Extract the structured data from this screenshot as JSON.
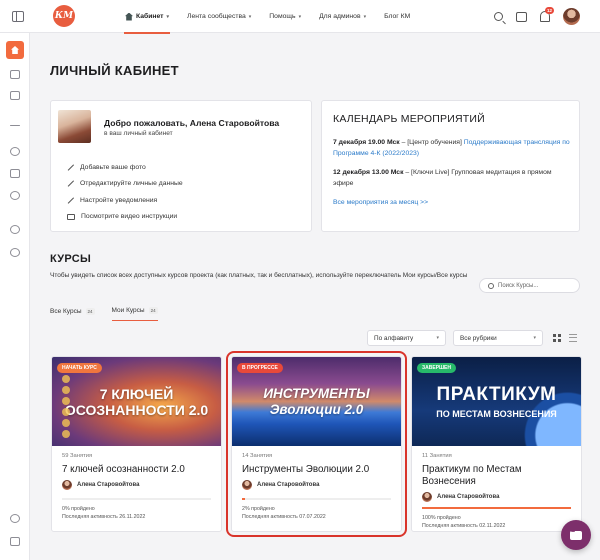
{
  "header": {
    "logo_text": "КМ",
    "nav": [
      {
        "label": "Кабинет",
        "has_chevron": true,
        "active": true
      },
      {
        "label": "Лента сообщества",
        "has_chevron": true
      },
      {
        "label": "Помощь",
        "has_chevron": true
      },
      {
        "label": "Для админов",
        "has_chevron": true
      },
      {
        "label": "Блог КМ",
        "has_chevron": false
      }
    ],
    "notification_count": "12",
    "icons": [
      "sidebar-toggle-icon",
      "search-icon",
      "inbox-icon",
      "bell-icon",
      "avatar"
    ]
  },
  "sidebar_rail": {
    "icons": [
      "home-icon",
      "graduation-cap-icon",
      "briefcase-icon",
      "activity-icon",
      "groups-icon",
      "chat-icon",
      "members-icon",
      "help-icon",
      "settings-icon",
      "collapse-icon"
    ]
  },
  "page": {
    "title": "ЛИЧНЫЙ КАБИНЕТ"
  },
  "welcome": {
    "greeting": "Добро пожаловать,  Алена Старовойтова",
    "subtitle": "в ваш личный кабинет",
    "actions": [
      "Добавьте ваше фото",
      "Отредактируйте личные данные",
      "Настройте уведомления",
      "Посмотрите видео инструкции"
    ]
  },
  "events": {
    "title": "КАЛЕНДАРЬ МЕРОПРИЯТИЙ",
    "items": [
      {
        "date": "7 декабря 19.00 Мск",
        "prefix": " – [Центр обучения] ",
        "link": "Поддерживающая трансляция по Программе 4-К (2022/2023)",
        "rest": ""
      },
      {
        "date": "12 декабря 13.00 Мск",
        "prefix": " – [Ключи Live] Групповая медитация в прямом эфире",
        "link": "",
        "rest": ""
      }
    ],
    "all_link": "Все мероприятия за месяц >>"
  },
  "courses_section": {
    "title": "КУРСЫ",
    "description": "Чтобы увидеть список всех доступных курсов проекта (как платных, так и бесплатных), используйте переключатель Мои курсы/Все курсы",
    "search_placeholder": "Поиск Курсы...",
    "tabs": [
      {
        "label": "Все Курсы",
        "count": "24",
        "active": false
      },
      {
        "label": "Мои Курсы",
        "count": "24",
        "active": true
      }
    ],
    "sort_select": "По алфавиту",
    "category_select": "Все рубрики",
    "view": "grid"
  },
  "courses": [
    {
      "status": "НАЧАТЬ КУРС",
      "status_color": "#f0763e",
      "banner_text": "7 КЛЮЧЕЙ ОСОЗНАННОСТИ 2.0",
      "banner_line1": "7 КЛЮЧЕЙ",
      "banner_line2": "ОСОЗНАННОСТИ 2.0",
      "lessons": "59 Занятия",
      "title": "7 ключей осознанности 2.0",
      "author": "Алена Старовойтова",
      "progress": 0,
      "progress_text": "0% пройдено",
      "last_activity": "Последняя активность 26.11.2022"
    },
    {
      "status": "В ПРОГРЕССЕ",
      "status_color": "#e8493a",
      "banner_line1": "ИНСТРУМЕНТЫ",
      "banner_line2": "Эволюции 2.0",
      "lessons": "14 Занятия",
      "title": "Инструменты Эволюции 2.0",
      "author": "Алена Старовойтова",
      "progress": 2,
      "progress_text": "2% пройдено",
      "last_activity": "Последняя активность 07.07.2022",
      "highlighted": true
    },
    {
      "status": "ЗАВЕРШЕН",
      "status_color": "#27b96a",
      "banner_line1": "ПРАКТИКУМ",
      "banner_line2": "ПО МЕСТАМ ВОЗНЕСЕНИЯ",
      "lessons": "11 Занятия",
      "title": "Практикум по Местам Вознесения",
      "author": "Алена Старовойтова",
      "progress": 100,
      "progress_text": "100% пройдено",
      "last_activity": "Последняя активность 02.11.2022"
    }
  ],
  "colors": {
    "accent": "#e85d3f",
    "link": "#2a7ac9",
    "chat_button": "#7d2f6b",
    "highlight_outline": "#d9342b"
  }
}
